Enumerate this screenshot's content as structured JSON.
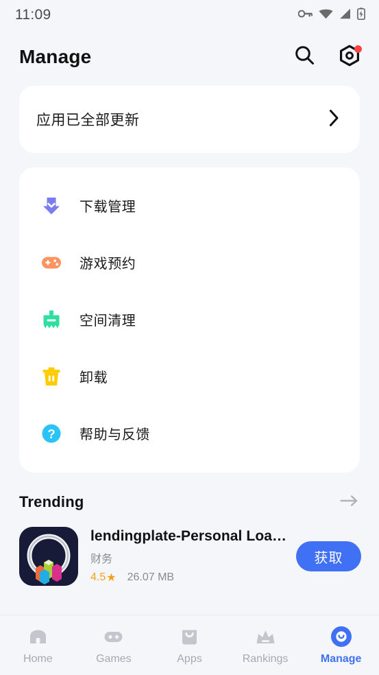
{
  "status_bar": {
    "time": "11:09",
    "icons": [
      "key-icon",
      "wifi-icon",
      "cellular-signal-icon",
      "battery-charging-icon"
    ]
  },
  "header": {
    "title": "Manage",
    "search_icon": "search-icon",
    "settings_icon": "settings-gear-icon",
    "has_notification_dot": true
  },
  "update_card": {
    "text": "应用已全部更新",
    "chevron": "chevron-right-icon"
  },
  "menu": {
    "items": [
      {
        "label": "下载管理",
        "icon": "download-icon",
        "color": "#7B7BF2"
      },
      {
        "label": "游戏预约",
        "icon": "gamepad-icon",
        "color": "#FA9562"
      },
      {
        "label": "空间清理",
        "icon": "broom-clean-icon",
        "color": "#2EE0A0"
      },
      {
        "label": "卸载",
        "icon": "trash-icon",
        "color": "#FFCC00"
      },
      {
        "label": "帮助与反馈",
        "icon": "help-circle-icon",
        "color": "#2BC3F5"
      }
    ]
  },
  "trending": {
    "title": "Trending",
    "arrow_icon": "arrow-right-icon",
    "apps": [
      {
        "name": "lendingplate-Personal Loa…",
        "category": "财务",
        "rating": "4.5",
        "star": "★",
        "size": "26.07 MB",
        "action_label": "获取"
      }
    ]
  },
  "bottom_nav": {
    "active_index": 4,
    "active_color": "#4070F4",
    "inactive_color": "#A6A8B3",
    "items": [
      {
        "label": "Home",
        "icon": "home-icon"
      },
      {
        "label": "Games",
        "icon": "gamepad-icon"
      },
      {
        "label": "Apps",
        "icon": "shopping-bag-icon"
      },
      {
        "label": "Rankings",
        "icon": "crown-icon"
      },
      {
        "label": "Manage",
        "icon": "manage-smile-icon"
      }
    ]
  }
}
